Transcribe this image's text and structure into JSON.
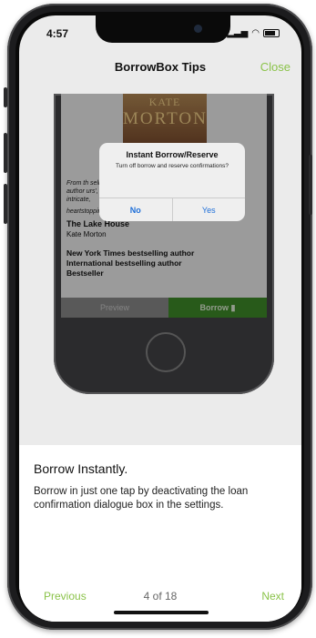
{
  "status_bar": {
    "time": "4:57"
  },
  "nav": {
    "title": "BorrowBox Tips",
    "close": "Close"
  },
  "mockup": {
    "book_cover": {
      "line1": "KATE",
      "line2": "MORTON"
    },
    "description_lines": [
      "From th                                        selling",
      "author                                         urs', an",
      "intricate,",
      "heartstopping suspense and uncovered secrets."
    ],
    "book_title": "The Lake House",
    "book_author": "Kate Morton",
    "blurb_lines": [
      "New York Times bestselling author",
      "International bestselling author",
      "Bestseller"
    ],
    "preview_label": "Preview",
    "borrow_label": "Borrow"
  },
  "alert": {
    "title": "Instant Borrow/Reserve",
    "message": "Turn off borrow and reserve confirmations?",
    "no": "No",
    "yes": "Yes"
  },
  "tip": {
    "title": "Borrow Instantly.",
    "description": "Borrow in just one tap by deactivating the loan confirmation dialogue box in the settings."
  },
  "pager": {
    "previous": "Previous",
    "counter": "4 of 18",
    "next": "Next"
  },
  "colors": {
    "accent": "#8bc34a",
    "borrow_button": "#3f8e2a",
    "alert_link": "#1e6fd9"
  }
}
